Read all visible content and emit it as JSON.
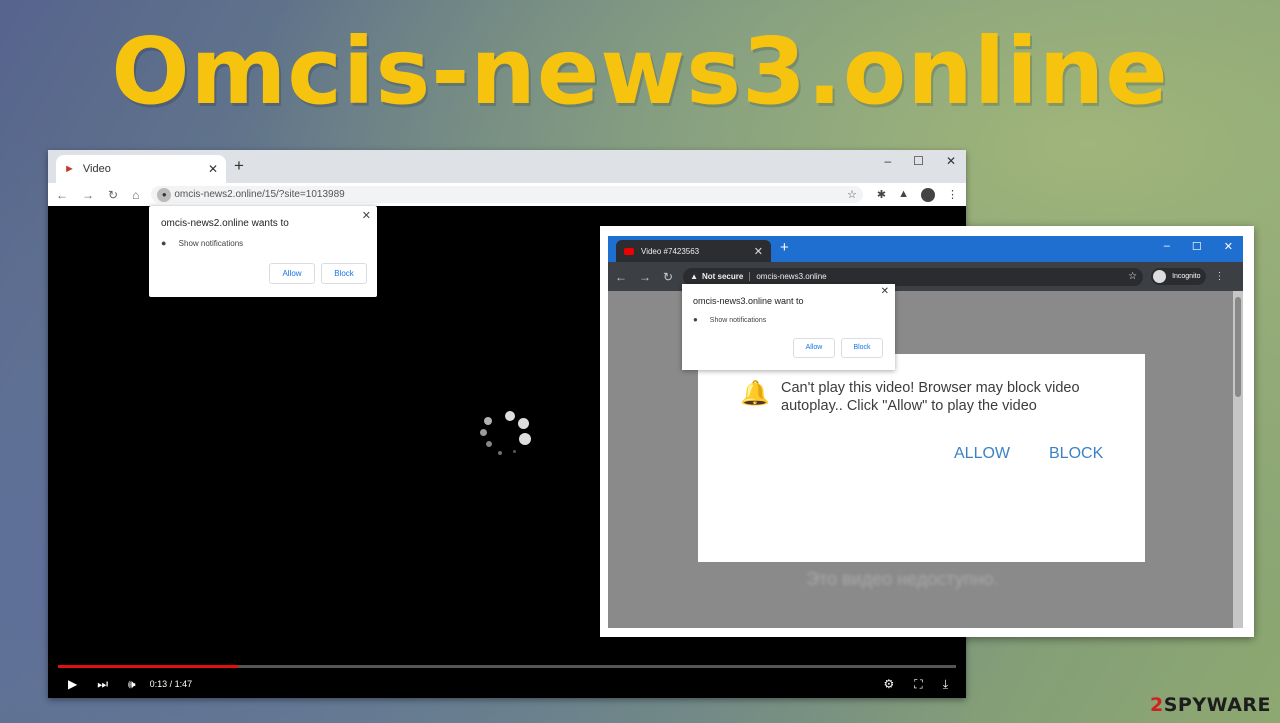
{
  "headline": "Omcis-news3.online",
  "browser1": {
    "tab_title": "Video",
    "url": "omcis-news2.online/15/?site=1013989",
    "prompt": {
      "title": "omcis-news2.online wants to",
      "row_text": "Show notifications",
      "allow": "Allow",
      "block": "Block"
    },
    "player": {
      "time": "0:13 / 1:47",
      "progress_fraction": 0.2
    }
  },
  "browser2": {
    "tab_title": "Video #7423563",
    "not_secure": "Not secure",
    "url": "omcis-news3.online",
    "incognito": "Incognito",
    "prompt": {
      "title": "omcis-news3.online want to",
      "row_text": "Show notifications",
      "allow": "Allow",
      "block": "Block"
    },
    "dialog": {
      "message": "Can't play this video! Browser may block video autoplay.. Click \"Allow\" to play the video",
      "allow": "ALLOW",
      "block": "BLOCK"
    },
    "blurred_text": "Это видео недоступно."
  },
  "watermark": {
    "prefix": "2",
    "name": "SPYWAR",
    "suffix": "E"
  },
  "colors": {
    "headline": "#f6c40f",
    "link_blue": "#1a73e8",
    "progress_red": "#e01010",
    "incognito_tabbar": "#1f6fd0"
  }
}
